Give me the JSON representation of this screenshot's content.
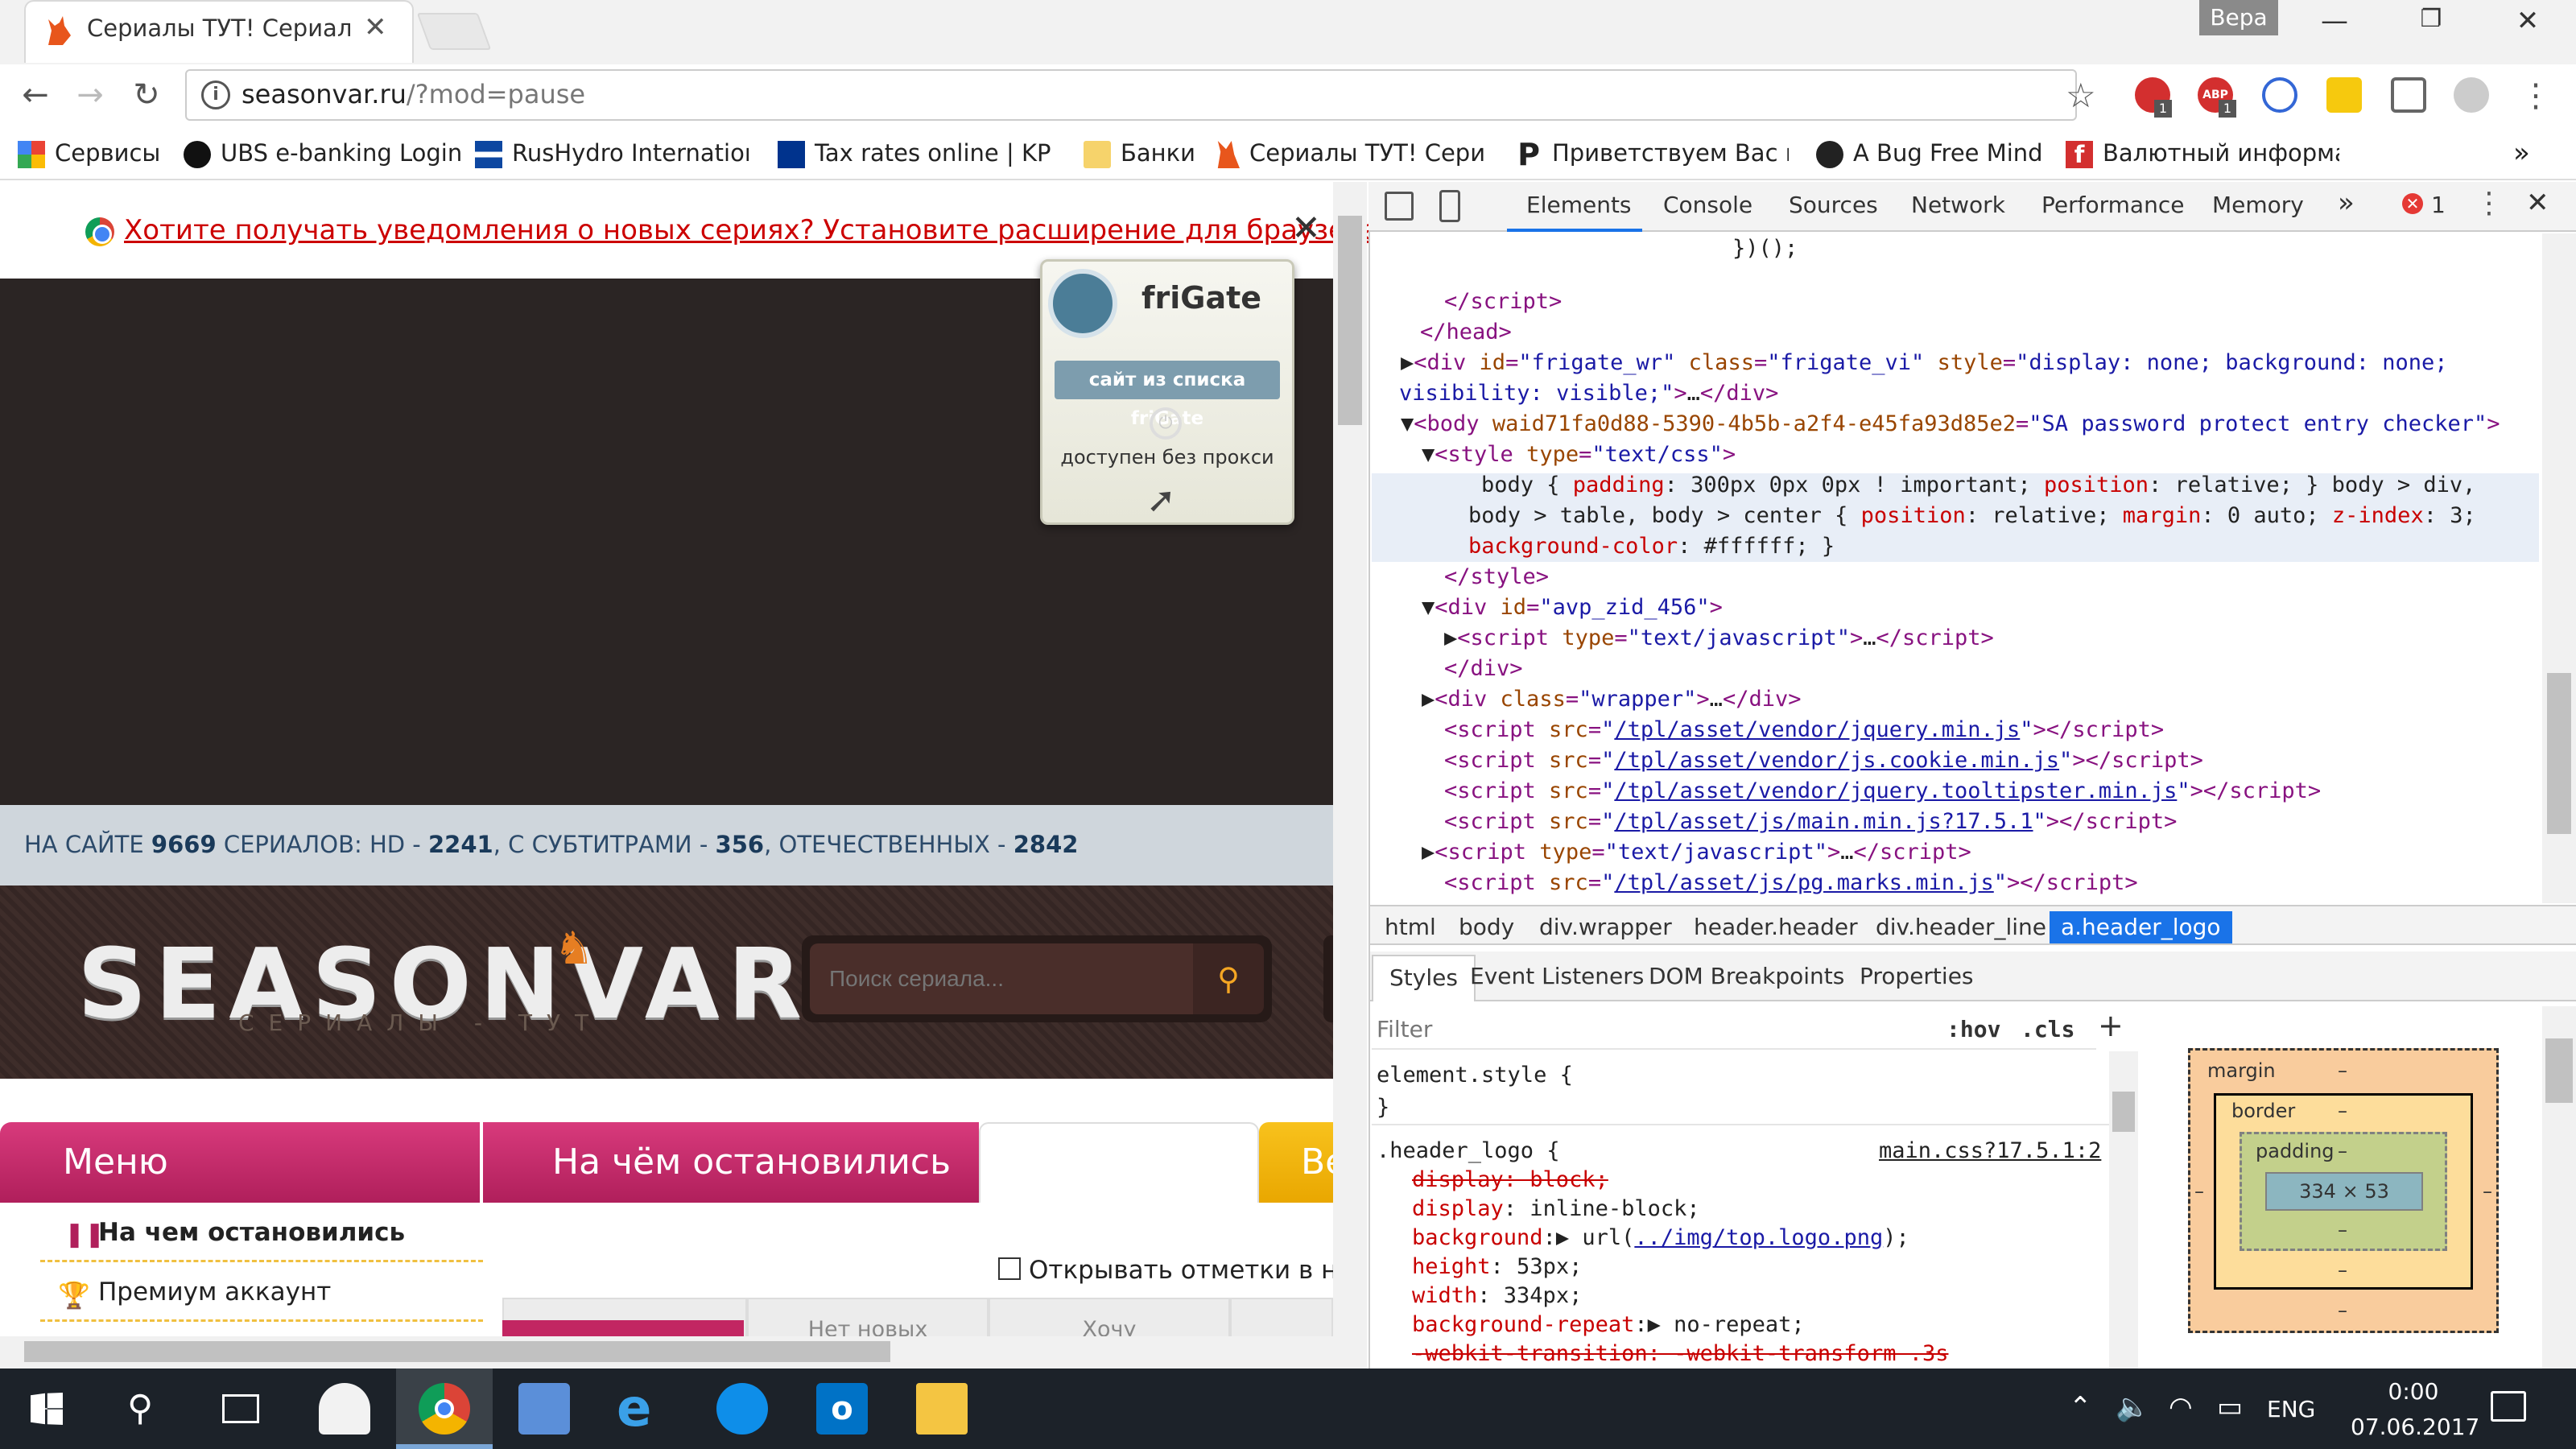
{
  "browser": {
    "tab_title": "Сериалы ТУТ! Сериалы",
    "user_name": "Вера",
    "url_host": "seasonvar.ru",
    "url_path": "/?mod=pause",
    "bookmarks": [
      {
        "label": "Сервисы",
        "icon": "apps-grid-icon"
      },
      {
        "label": "UBS e-banking Login",
        "icon": "ubs-keys-icon"
      },
      {
        "label": "RusHydro Internationa",
        "icon": "rushydro-icon"
      },
      {
        "label": "Tax rates online | KPM",
        "icon": "kpmg-icon"
      },
      {
        "label": "Банки",
        "icon": "folder-icon"
      },
      {
        "label": "Сериалы ТУТ! Сериал",
        "icon": "seasonvar-cat-icon"
      },
      {
        "label": "Приветствуем Вас на",
        "icon": "p-letter-icon"
      },
      {
        "label": "A Bug Free Mind",
        "icon": "bug-icon"
      },
      {
        "label": "Валютный информат",
        "icon": "red-f-icon"
      }
    ],
    "bookmarks_more": "»",
    "extension_badges": [
      "1",
      "1"
    ]
  },
  "page": {
    "notify_text": "Хотите получать уведомления о новых сериях? Установите расширение для браузера",
    "frigate": {
      "title": "friGate",
      "button": "сайт из списка friGate",
      "status": "доступен без прокси"
    },
    "stats": {
      "prefix": "НА САЙТЕ ",
      "total": "9669",
      "mid1": " СЕРИАЛОВ: HD - ",
      "hd": "2241",
      "mid2": ", С СУБТИТРАМИ - ",
      "subs": "356",
      "mid3": ", ОТЕЧЕСТВЕННЫХ - ",
      "domestic": "2842"
    },
    "logo_text": "SEASONVAR",
    "logo_sub": "СЕРИАЛЫ - ТУТ",
    "search_placeholder": "Поиск сериала...",
    "tabs": {
      "menu": "Меню",
      "stopped": "На чём остановились",
      "orange": "Ве"
    },
    "side_menu": [
      "На чем остановились",
      "Премиум аккаунт"
    ],
    "open_marks": "Открывать отметки в нов",
    "sub_tabs": [
      "",
      "Нет новых",
      "Хочу",
      ""
    ]
  },
  "devtools": {
    "tabs": [
      "Elements",
      "Console",
      "Sources",
      "Network",
      "Performance",
      "Memory"
    ],
    "more": "»",
    "error_count": "1",
    "breadcrumbs": [
      "html",
      "body",
      "div.wrapper",
      "header.header",
      "div.header_line",
      "a.header_logo"
    ],
    "styles_tabs": [
      "Styles",
      "Event Listeners",
      "DOM Breakpoints",
      "Properties"
    ],
    "filter_placeholder": "Filter",
    "hov": ":hov",
    "cls": ".cls",
    "rule_source": "main.css?17.5.1:2",
    "box_model": {
      "margin": "margin",
      "border": "border",
      "padding": "padding",
      "dash": "–",
      "content": "334 × 53",
      "side": "–"
    }
  },
  "taskbar": {
    "time": "0:00",
    "date": "07.06.2017",
    "lang": "ENG"
  }
}
